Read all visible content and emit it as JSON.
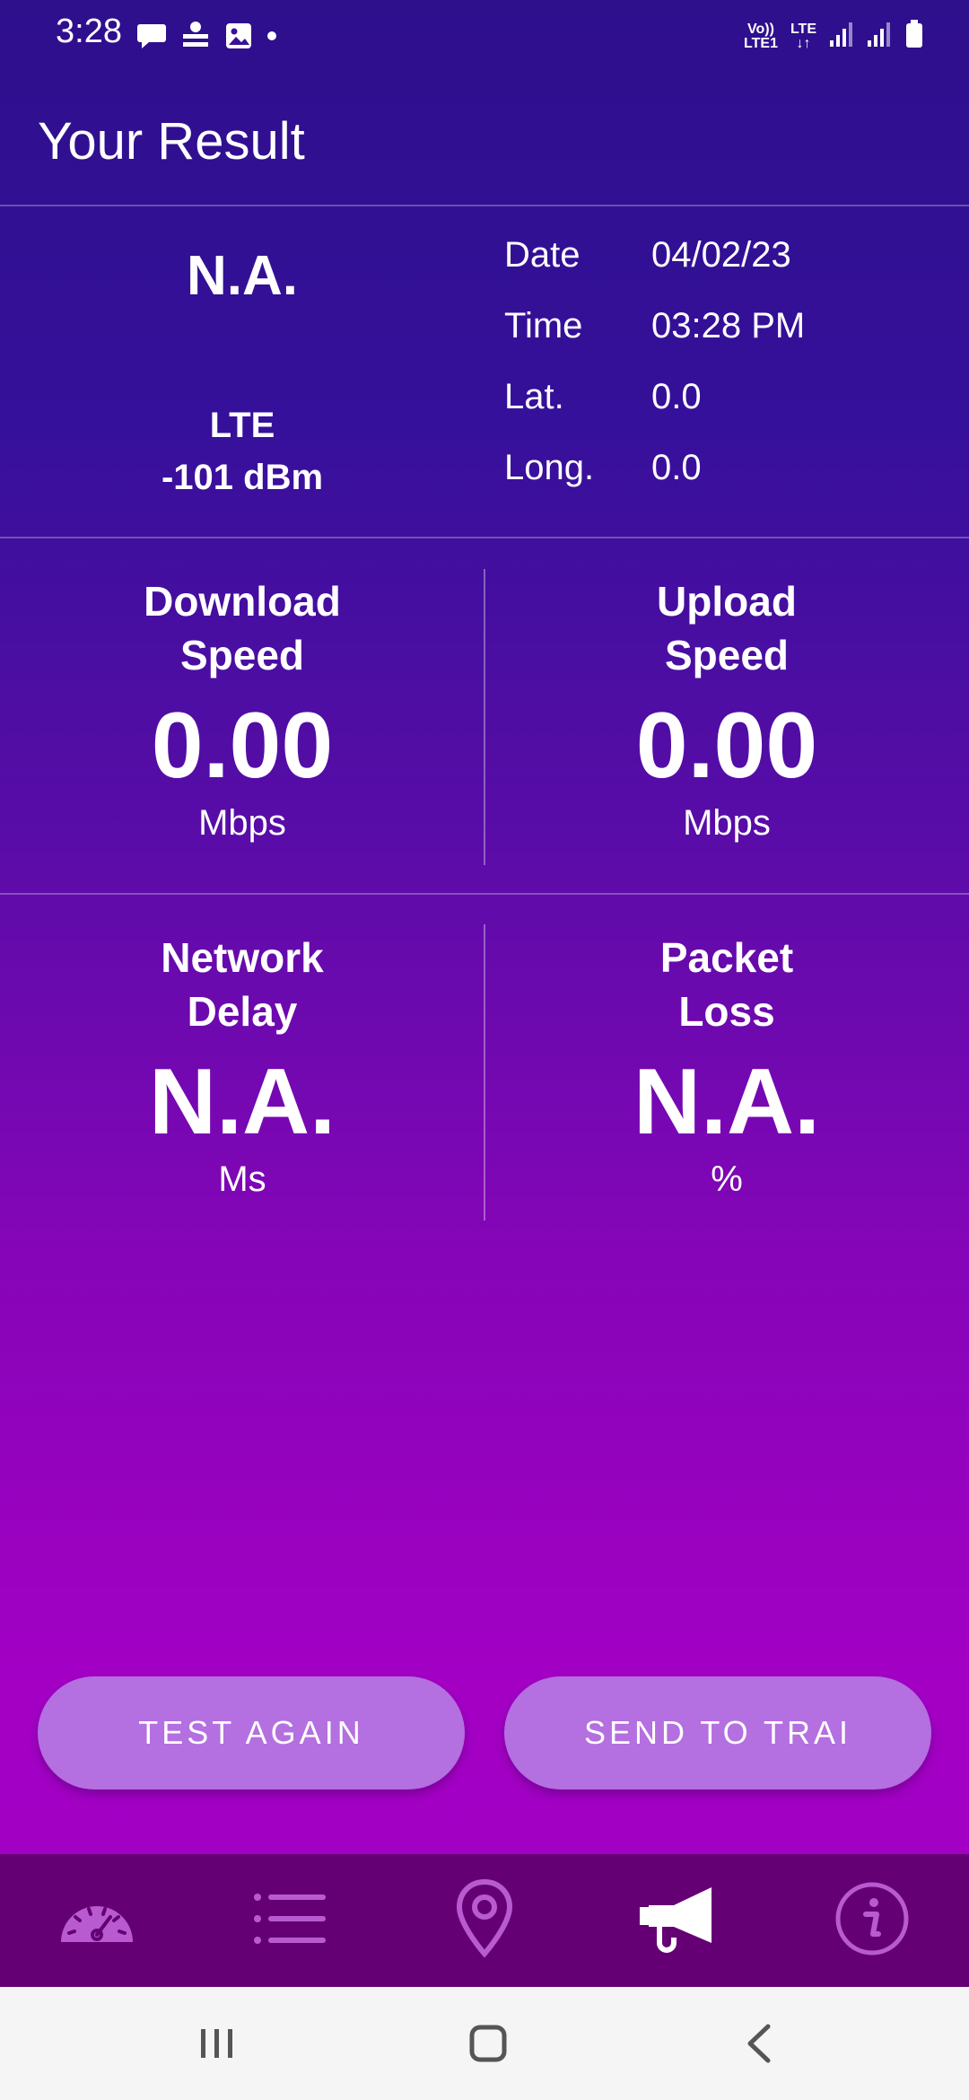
{
  "status_bar": {
    "time": "3:28",
    "left_icons": [
      "chat-icon",
      "dainik-bhaskar-icon",
      "gallery-icon",
      "dot-icon"
    ],
    "volte_label": "Vo))",
    "lte1_label": "LTE1",
    "lte_label": "LTE"
  },
  "header": {
    "title": "Your Result"
  },
  "summary": {
    "operator": "N.A.",
    "network_type": "LTE",
    "signal_strength": "-101 dBm",
    "info": [
      {
        "label": "Date",
        "value": "04/02/23"
      },
      {
        "label": "Time",
        "value": "03:28 PM"
      },
      {
        "label": "Lat.",
        "value": "0.0"
      },
      {
        "label": "Long.",
        "value": "0.0"
      }
    ]
  },
  "metrics": {
    "download": {
      "title_line1": "Download",
      "title_line2": "Speed",
      "value": "0.00",
      "unit": "Mbps"
    },
    "upload": {
      "title_line1": "Upload",
      "title_line2": "Speed",
      "value": "0.00",
      "unit": "Mbps"
    },
    "delay": {
      "title_line1": "Network",
      "title_line2": "Delay",
      "value": "N.A.",
      "unit": "Ms"
    },
    "loss": {
      "title_line1": "Packet",
      "title_line2": "Loss",
      "value": "N.A.",
      "unit": "%"
    }
  },
  "buttons": {
    "test_again": "TEST AGAIN",
    "send_to_trai": "SEND TO TRAI"
  },
  "bottom_nav": {
    "items": [
      "speedometer-icon",
      "list-icon",
      "location-pin-icon",
      "megaphone-icon",
      "info-icon"
    ],
    "active": "megaphone-icon"
  },
  "colors": {
    "accent_top": "#2e0f8c",
    "accent_bottom": "#a300c4",
    "button": "#b46fe0",
    "nav_bg": "#650074"
  }
}
